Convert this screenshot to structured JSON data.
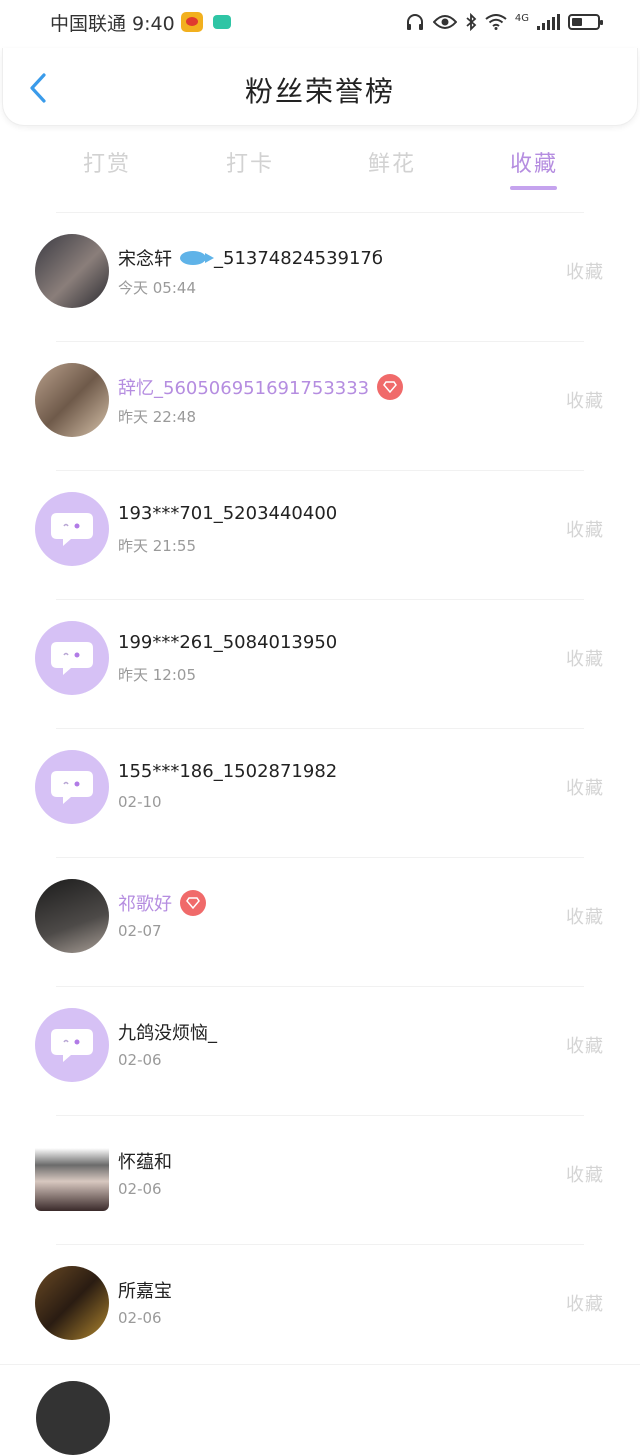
{
  "status_bar": {
    "carrier_time": "中国联通 9:40",
    "network": "4G"
  },
  "header": {
    "title": "粉丝荣誉榜"
  },
  "tabs": [
    {
      "label": "打赏",
      "active": false
    },
    {
      "label": "打卡",
      "active": false
    },
    {
      "label": "鲜花",
      "active": false
    },
    {
      "label": "收藏",
      "active": true
    }
  ],
  "colors": {
    "accent": "#b58de0",
    "inactive_tab": "#d2d2d2",
    "default_avatar": "#d6c1f5",
    "diamond_badge": "#f06a6a"
  },
  "fans": [
    {
      "name": "宋念轩",
      "name_suffix": "_5137482453917б",
      "time": "今天 05:44",
      "action": "收藏",
      "vip": false,
      "fish_icon": true
    },
    {
      "name": "辞忆_560506951691753333",
      "name_suffix": "",
      "time": "昨天 22:48",
      "action": "收藏",
      "vip": true
    },
    {
      "name": "193***701_5203440400",
      "name_suffix": "",
      "time": "昨天 21:55",
      "action": "收藏",
      "vip": false
    },
    {
      "name": "199***261_5084013950",
      "name_suffix": "",
      "time": "昨天 12:05",
      "action": "收藏",
      "vip": false
    },
    {
      "name": "155***186_1502871982",
      "name_suffix": "",
      "time": "02-10",
      "action": "收藏",
      "vip": false
    },
    {
      "name": "祁歌好",
      "name_suffix": "",
      "time": "02-07",
      "action": "收藏",
      "vip": true
    },
    {
      "name": "九鸽没烦恼_",
      "name_suffix": "",
      "time": "02-06",
      "action": "收藏",
      "vip": false
    },
    {
      "name": "怀蕴和",
      "name_suffix": "",
      "time": "02-06",
      "action": "收藏",
      "vip": false
    },
    {
      "name": "所嘉宝",
      "name_suffix": "",
      "time": "02-06",
      "action": "收藏",
      "vip": false
    }
  ]
}
